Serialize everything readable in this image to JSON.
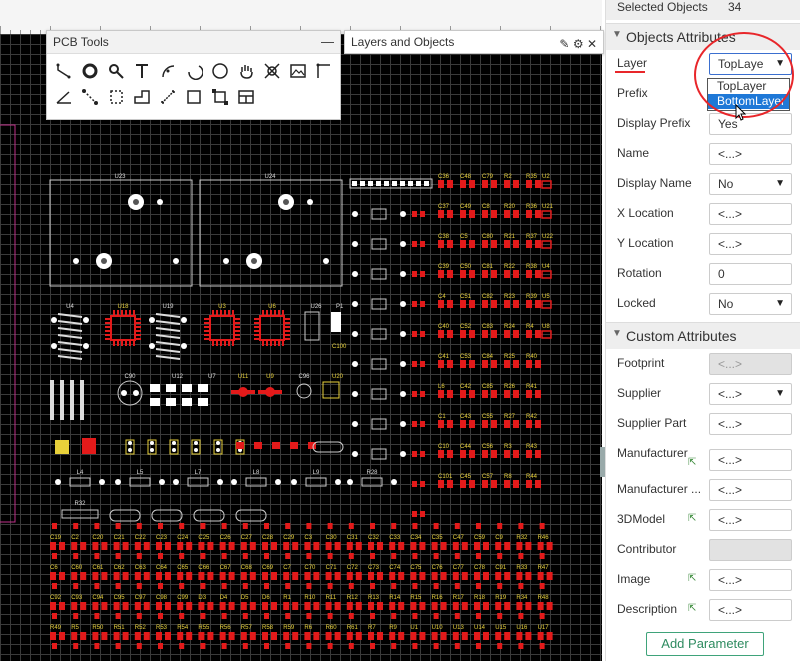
{
  "pcb_tools": {
    "title": "PCB Tools",
    "minimize": "—",
    "tools": [
      {
        "name": "track-icon"
      },
      {
        "name": "via-icon"
      },
      {
        "name": "pad-icon"
      },
      {
        "name": "text-icon"
      },
      {
        "name": "arc-icon"
      },
      {
        "name": "arc-center-icon"
      },
      {
        "name": "circle-icon"
      },
      {
        "name": "pan-icon"
      },
      {
        "name": "move-icon"
      },
      {
        "name": "image-icon"
      },
      {
        "name": "line-icon"
      },
      {
        "name": "angle-icon"
      },
      {
        "name": "connect-icon"
      },
      {
        "name": "solid-region-icon"
      },
      {
        "name": "polygon-icon"
      },
      {
        "name": "dimension-icon"
      },
      {
        "name": "rectangle-icon"
      },
      {
        "name": "group-icon"
      },
      {
        "name": "table-icon"
      }
    ]
  },
  "layers_panel": {
    "title": "Layers and Objects"
  },
  "sidebar": {
    "selected_label": "Selected Objects",
    "selected_count": "34",
    "objects_section": "Objects Attributes",
    "custom_section": "Custom Attributes",
    "rows": {
      "layer": {
        "label": "Layer",
        "value": "TopLaye"
      },
      "prefix": {
        "label": "Prefix"
      },
      "display_prefix": {
        "label": "Display Prefix",
        "value": "Yes"
      },
      "name": {
        "label": "Name",
        "value": "<...>"
      },
      "display_name": {
        "label": "Display Name",
        "value": "No"
      },
      "x_location": {
        "label": "X Location",
        "value": "<...>"
      },
      "y_location": {
        "label": "Y Location",
        "value": "<...>"
      },
      "rotation": {
        "label": "Rotation",
        "value": "0"
      },
      "locked": {
        "label": "Locked",
        "value": "No"
      },
      "footprint": {
        "label": "Footprint",
        "value": "<...>"
      },
      "supplier": {
        "label": "Supplier",
        "value": "<...>"
      },
      "supplier_part": {
        "label": "Supplier Part",
        "value": "<...>"
      },
      "manufacturer": {
        "label": "Manufacturer",
        "value": "<...>"
      },
      "manufacturer_part": {
        "label": "Manufacturer ...",
        "value": "<...>"
      },
      "model3d": {
        "label": "3DModel",
        "value": "<...>"
      },
      "contributor": {
        "label": "Contributor",
        "value": ""
      },
      "image": {
        "label": "Image",
        "value": "<...>"
      },
      "description": {
        "label": "Description",
        "value": "<...>"
      }
    },
    "layer_options": [
      "TopLayer",
      "BottomLayer"
    ],
    "add_parameter": "Add Parameter"
  },
  "board_labels": {
    "u23": "U23",
    "u24": "U24",
    "u4": "U4",
    "u18": "U18",
    "u19": "U19",
    "u3": "U3",
    "u6": "U6",
    "u26": "U26",
    "p1": "P1",
    "c100": "C100",
    "u12": "U12",
    "u7": "U7",
    "u11": "U11",
    "u9": "U9",
    "c96": "C96",
    "u20": "U20",
    "c90": "C90",
    "l4": "L4",
    "l5": "L5",
    "l7": "L7",
    "l8": "L8",
    "l9": "L9",
    "r28": "R28",
    "r32": "R32",
    "col1": [
      "C36",
      "C37",
      "C38",
      "C39",
      "C4",
      "C40",
      "C41",
      "L6",
      "C1",
      "C10",
      "C101"
    ],
    "col2": [
      "C48",
      "C49",
      "C5",
      "C50",
      "C51",
      "C52",
      "C53",
      "C42",
      "C43",
      "C44",
      "C45"
    ],
    "col3": [
      "C79",
      "C8",
      "C80",
      "C81",
      "C82",
      "C83",
      "C84",
      "C85",
      "C55",
      "C56",
      "C57"
    ],
    "col4": [
      "R2",
      "R20",
      "R21",
      "R22",
      "R23",
      "R24",
      "R25",
      "R26",
      "R27",
      "R3",
      "R8"
    ],
    "col5": [
      "R35",
      "R36",
      "R37",
      "R38",
      "R39",
      "R4",
      "R40",
      "R41",
      "R42",
      "R43",
      "R44"
    ],
    "col6": [
      "U2",
      "U21",
      "U22",
      "U4",
      "U5",
      "U8",
      "",
      "",
      "",
      "",
      ""
    ],
    "row_a": [
      "C19",
      "C2",
      "C20",
      "C21",
      "C22",
      "C23",
      "C24",
      "C25",
      "C26",
      "C27",
      "C28",
      "C29",
      "C3",
      "C30",
      "C31",
      "C32",
      "C33",
      "C34",
      "C35",
      "C47",
      "C59",
      "C9",
      "R32",
      "R46"
    ],
    "row_b": [
      "C6",
      "C60",
      "C61",
      "C62",
      "C63",
      "C64",
      "C65",
      "C66",
      "C67",
      "C68",
      "C69",
      "C7",
      "C70",
      "C71",
      "C72",
      "C73",
      "C74",
      "C75",
      "C76",
      "C77",
      "C78",
      "C91",
      "R33",
      "R47"
    ],
    "row_c": [
      "C92",
      "C93",
      "C94",
      "C95",
      "C97",
      "C98",
      "C99",
      "D3",
      "D4",
      "D5",
      "D6",
      "R1",
      "R10",
      "R11",
      "R12",
      "R13",
      "R14",
      "R15",
      "R16",
      "R17",
      "R18",
      "R19",
      "R34",
      "R48"
    ],
    "row_d": [
      "R49",
      "R5",
      "R50",
      "R51",
      "R52",
      "R53",
      "R54",
      "R55",
      "R56",
      "R57",
      "R58",
      "R59",
      "R6",
      "R60",
      "R61",
      "R7",
      "R9",
      "U1",
      "U10",
      "U13",
      "U14",
      "U15",
      "U16",
      "U17"
    ]
  }
}
